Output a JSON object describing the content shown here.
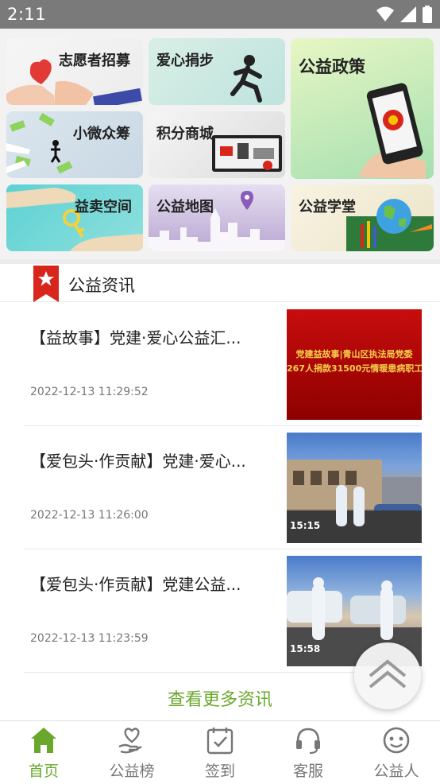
{
  "status_bar": {
    "time": "2:11"
  },
  "grid": {
    "tiles": [
      {
        "label": "志愿者招募"
      },
      {
        "label": "爱心捐步"
      },
      {
        "label": "公益政策"
      },
      {
        "label": "小微众筹"
      },
      {
        "label": "积分商城"
      },
      {
        "label": "益卖空间"
      },
      {
        "label": "公益地图"
      },
      {
        "label": "公益学堂"
      }
    ]
  },
  "section": {
    "title": "公益资讯"
  },
  "news": [
    {
      "title": "【益故事】党建·爱心公益汇...",
      "date": "2022-12-13 11:29:52",
      "thumb_lines": [
        "党建益故事|青山区执法局党委",
        "267人捐款31500元情暖患病职工"
      ]
    },
    {
      "title": "【爱包头·作贡献】党建·爱心...",
      "date": "2022-12-13 11:26:00",
      "thumb_time": "15:15"
    },
    {
      "title": "【爱包头·作贡献】党建公益...",
      "date": "2022-12-13 11:23:59",
      "thumb_time": "15:58"
    }
  ],
  "more_link": "查看更多资讯",
  "tabbar": {
    "tabs": [
      {
        "label": "首页"
      },
      {
        "label": "公益榜"
      },
      {
        "label": "签到"
      },
      {
        "label": "客服"
      },
      {
        "label": "公益人"
      }
    ]
  },
  "colors": {
    "accent": "#6aa82d",
    "badge": "#d9261c"
  }
}
